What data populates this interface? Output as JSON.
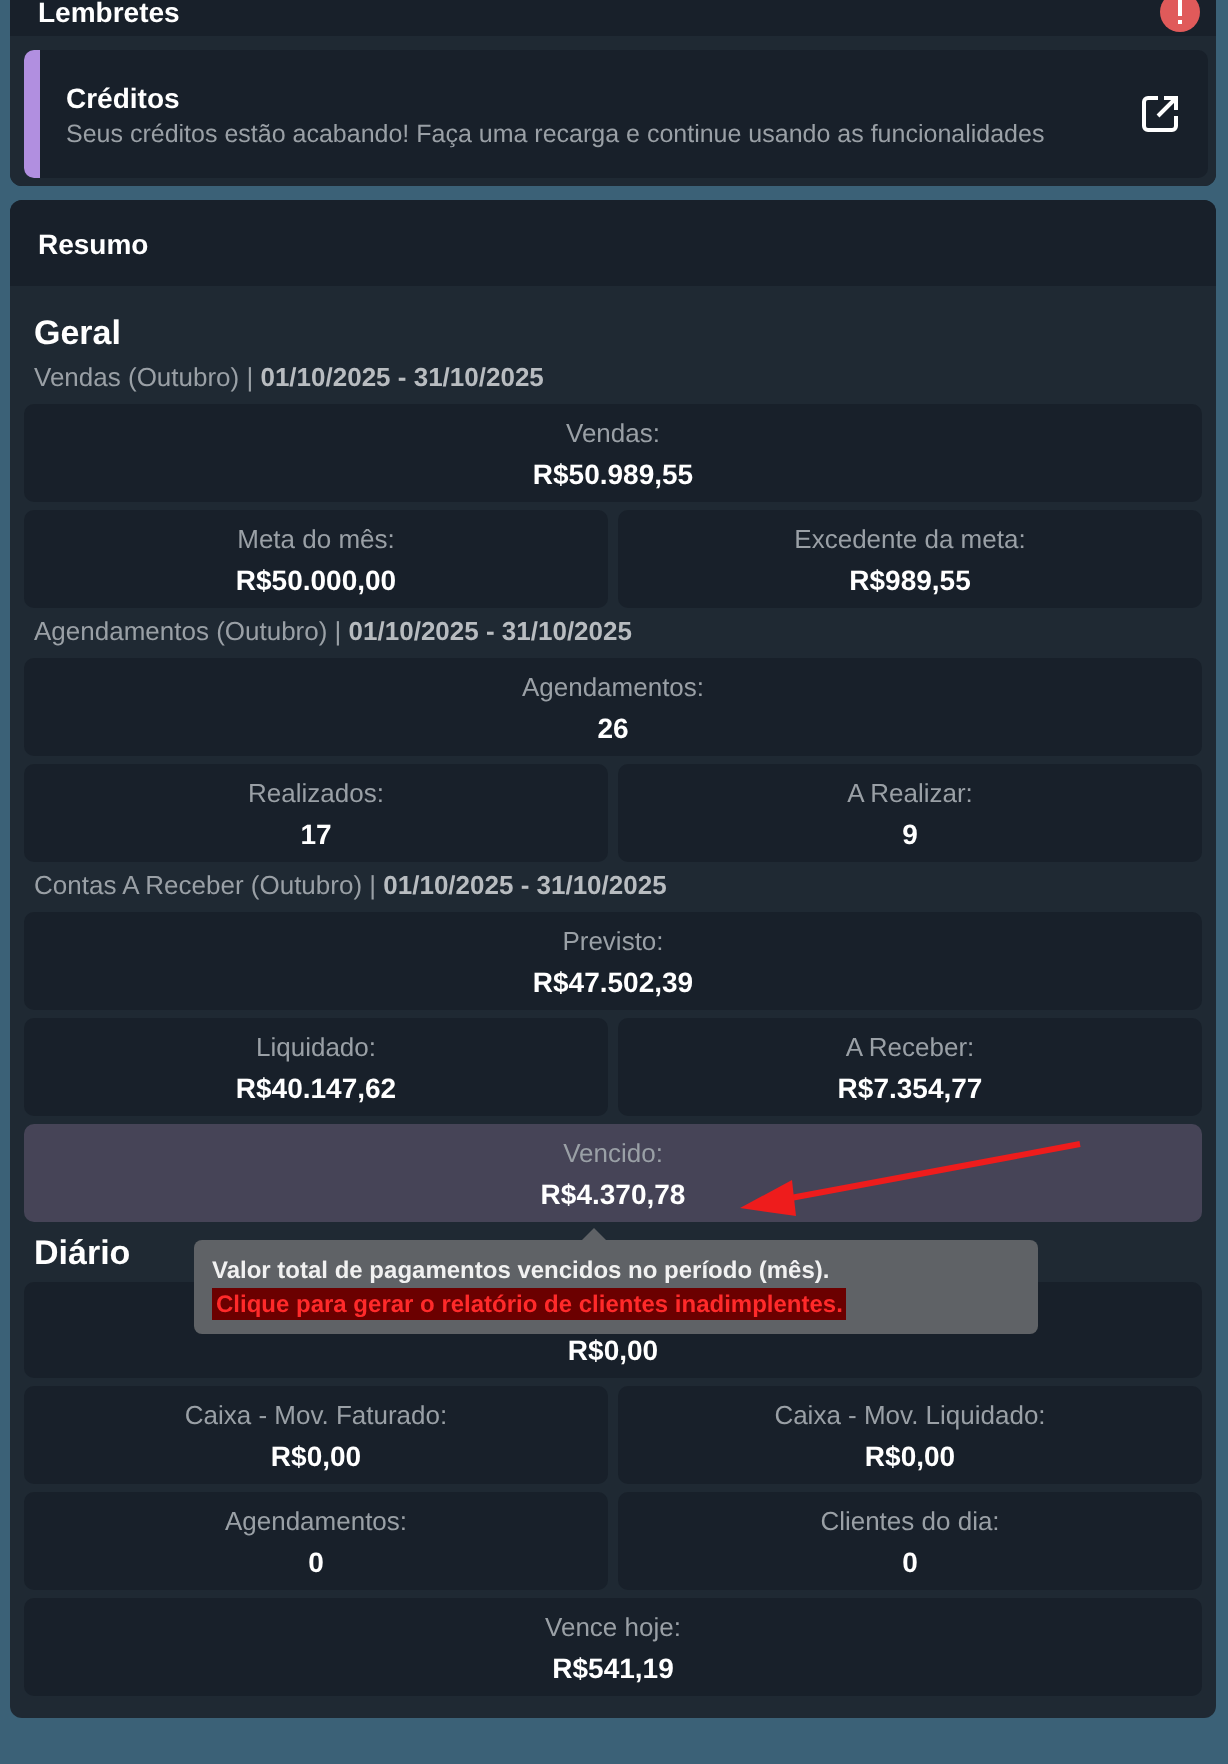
{
  "reminders": {
    "title": "Lembretes",
    "items": [
      {
        "title": "Créditos",
        "message": "Seus créditos estão acabando! Faça uma recarga e continue usando as funcionalidades",
        "color": "#b18fe0"
      }
    ]
  },
  "summary": {
    "title": "Resumo",
    "sections": [
      {
        "title": "Geral",
        "groups": [
          {
            "heading": "Vendas (Outubro) | **01/10/2025 - 31/10/2025**",
            "rows": [
              [
                {
                  "label": "Vendas:",
                  "value": "R$50.989,55",
                  "highlighted": false
                }
              ],
              [
                {
                  "label": "Meta do mês:",
                  "value": "R$50.000,00",
                  "highlighted": false
                },
                {
                  "label": "Excedente da meta:",
                  "value": "R$989,55",
                  "highlighted": false
                }
              ]
            ]
          },
          {
            "heading": "Agendamentos (Outubro) | **01/10/2025 - 31/10/2025**",
            "rows": [
              [
                {
                  "label": "Agendamentos:",
                  "value": "26",
                  "highlighted": false
                }
              ],
              [
                {
                  "label": "Realizados:",
                  "value": "17",
                  "highlighted": false
                },
                {
                  "label": "A Realizar:",
                  "value": "9",
                  "highlighted": false
                }
              ]
            ]
          },
          {
            "heading": "Contas A Receber (Outubro) | **01/10/2025 - 31/10/2025**",
            "rows": [
              [
                {
                  "label": "Previsto:",
                  "value": "R$47.502,39",
                  "highlighted": false
                }
              ],
              [
                {
                  "label": "Liquidado:",
                  "value": "R$40.147,62",
                  "highlighted": false
                },
                {
                  "label": "A Receber:",
                  "value": "R$7.354,77",
                  "highlighted": false
                }
              ],
              [
                {
                  "label": "Vencido:",
                  "value": "R$4.370,78",
                  "highlighted": true,
                  "tooltip": {
                    "text": "Valor total de pagamentos vencidos no período (mês).",
                    "link": "Clique para gerar o relatório de clientes inadimplentes."
                  }
                }
              ]
            ]
          }
        ]
      },
      {
        "title": "Diário",
        "groups": [
          {
            "rows": [
              [
                {
                  "value": "R$0,00",
                  "highlighted": false
                }
              ],
              [
                {
                  "label": "Caixa - Mov. Faturado:",
                  "value": "R$0,00",
                  "highlighted": false
                },
                {
                  "label": "Caixa - Mov. Liquidado:",
                  "value": "R$0,00",
                  "highlighted": false
                }
              ],
              [
                {
                  "label": "Agendamentos:",
                  "value": "0",
                  "highlighted": false
                },
                {
                  "label": "Clientes do dia:",
                  "value": "0",
                  "highlighted": false
                }
              ],
              [
                {
                  "label": "Vence hoje:",
                  "value": "R$541,19",
                  "highlighted": false
                }
              ]
            ]
          }
        ]
      }
    ]
  }
}
